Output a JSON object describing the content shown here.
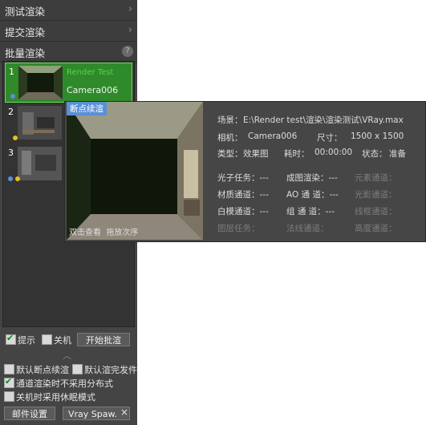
{
  "panel": {
    "sections": {
      "test_render": "测试渲染",
      "submit_render": "提交渲染",
      "batch_render": "批量渲染",
      "help": "?"
    },
    "items": [
      {
        "num": "1",
        "camera": "Camera006",
        "secondary": "Render Test"
      },
      {
        "num": "2",
        "camera": "C"
      },
      {
        "num": "3",
        "camera": "C"
      }
    ],
    "footer": {
      "show_tip": "提示",
      "shutdown": "关机",
      "start_batch": "开始批渲",
      "default_resume": "默认断点续渲",
      "default_send_after": "默认渲完发件",
      "channel_no_distributed": "通道渲染时不采用分布式",
      "hibernate_on_shutdown": "关机时采用休眠模式",
      "mail_settings": "邮件设置",
      "vray_spawn": "Vray Spaw.",
      "close": "×",
      "chevron": "︿"
    }
  },
  "popup": {
    "tag": "断点续渲",
    "link_view": "双击查看",
    "link_drag": "拖放次序",
    "scene_label": "场景：",
    "scene_value": "E:\\Render test\\渲染\\渲染测试\\VRay.max",
    "camera_label": "相机：",
    "camera_value": "Camera006",
    "size_label": "尺寸：",
    "size_value": "1500 x 1500",
    "type_label": "类型：",
    "type_value": "效果图",
    "time_label": "耗时：",
    "time_value": "00:00:00",
    "status_label": "状态：",
    "status_value": "准备",
    "grid": [
      [
        "光子任务：---",
        "成图渲染：---",
        "元素通道："
      ],
      [
        "材质通道：---",
        "AO 通 道：---",
        "光影通道："
      ],
      [
        "白模通道：---",
        "组 通 道：---",
        "线框通道："
      ],
      [
        "图层任务：",
        "法线通道：",
        "高度通道："
      ]
    ]
  },
  "colors": {
    "panel_bg": "#444444",
    "selected_item": "#2f8a2a",
    "tag_blue": "#5b8fd6",
    "status_yellow": "#e6c21a",
    "status_blue": "#5b8fd6"
  }
}
